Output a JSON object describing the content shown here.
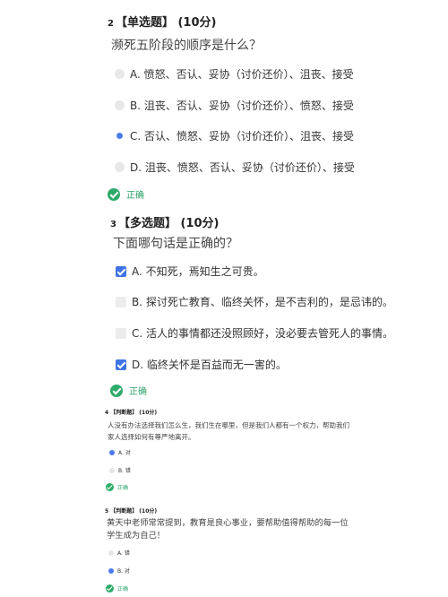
{
  "q2": {
    "number": "2",
    "type_label": "【单选题】 (10分)",
    "title": "濒死五阶段的顺序是什么？",
    "options": [
      {
        "label": "A. 愤怒、否认、妥协（讨价还价）、沮丧、接受",
        "selected": false
      },
      {
        "label": "B. 沮丧、否认、妥协（讨价还价）、愤怒、接受",
        "selected": false
      },
      {
        "label": "C. 否认、愤怒、妥协（讨价还价）、沮丧、接受",
        "selected": true
      },
      {
        "label": "D. 沮丧、愤怒、否认、妥协（讨价还价）、接受",
        "selected": false
      }
    ],
    "result": "正确"
  },
  "q3": {
    "number": "3",
    "type_label": "【多选题】 (10分)",
    "title": "下面哪句话是正确的？",
    "options": [
      {
        "label": "A. 不知死，焉知生之可贵。",
        "selected": true
      },
      {
        "label": "B. 探讨死亡教育、临终关怀，是不吉利的，是忌讳的。",
        "selected": false
      },
      {
        "label": "C. 活人的事情都还没照顾好，没必要去管死人的事情。",
        "selected": false
      },
      {
        "label": "D. 临终关怀是百益而无一害的。",
        "selected": true
      }
    ],
    "result": "正确"
  },
  "q4": {
    "number": "4",
    "type_label": "【判断题】 (10分)",
    "title": "人没有办法选择我们怎么生，我们生在哪里，但是我们人都有一个权力，帮助我们家人选择如何有尊严地离开。",
    "options": [
      {
        "label": "A. 对",
        "selected": true
      },
      {
        "label": "B. 错",
        "selected": false
      }
    ],
    "result": "正确"
  },
  "q5": {
    "number": "5",
    "type_label": "【判断题】 (10分)",
    "title": "黄天中老师常常提到，教育是良心事业，要帮助值得帮助的每一位学生成为自己！",
    "options": [
      {
        "label": "A. 错",
        "selected": false
      },
      {
        "label": "B. 对",
        "selected": true
      }
    ],
    "result": "正确"
  },
  "colors": {
    "accent": "#4a7bf1",
    "checkbox": "#3f73e6",
    "success": "#2eab6a"
  },
  "icons": {
    "correct": "check-circle-icon",
    "checkbox_checked": "checkbox-checked-icon",
    "radio_selected": "radio-selected-icon"
  }
}
